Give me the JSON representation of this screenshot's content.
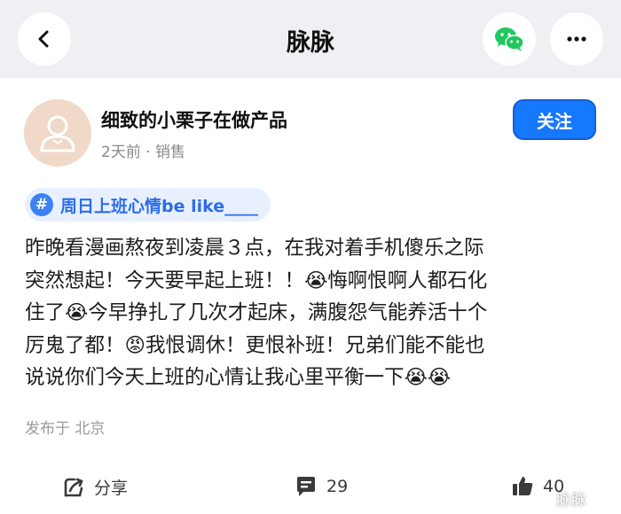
{
  "nav": {
    "title": "脉脉",
    "icons": [
      "back-icon",
      "wechat-icon",
      "more-icon"
    ]
  },
  "author": {
    "name": "细致的小栗子在做产品",
    "meta": "2天前 · 销售",
    "follow_label": "关注"
  },
  "topic": {
    "hash": "#",
    "label": "周日上班心情be like____"
  },
  "post": {
    "body": "昨晚看漫画熬夜到凌晨３点，在我对着手机傻乐之际\n突然想起！今天要早起上班！！😭悔啊恨啊人都石化\n住了😭今早挣扎了几次才起床，满腹怨气能养活十个\n厉鬼了都！😡我恨调休！更恨补班！兄弟们能不能也\n说说你们今天上班的心情让我心里平衡一下😭😭",
    "location": "发布于 北京"
  },
  "actions": {
    "share_label": "分享",
    "comment_count": "29",
    "like_count": "40"
  },
  "watermark": "脉脉",
  "colors": {
    "accent": "#1677ff",
    "topbar_bg": "#eff0f4",
    "wechat_green": "#1ec85e",
    "topic_bg": "#e8f0ff"
  }
}
